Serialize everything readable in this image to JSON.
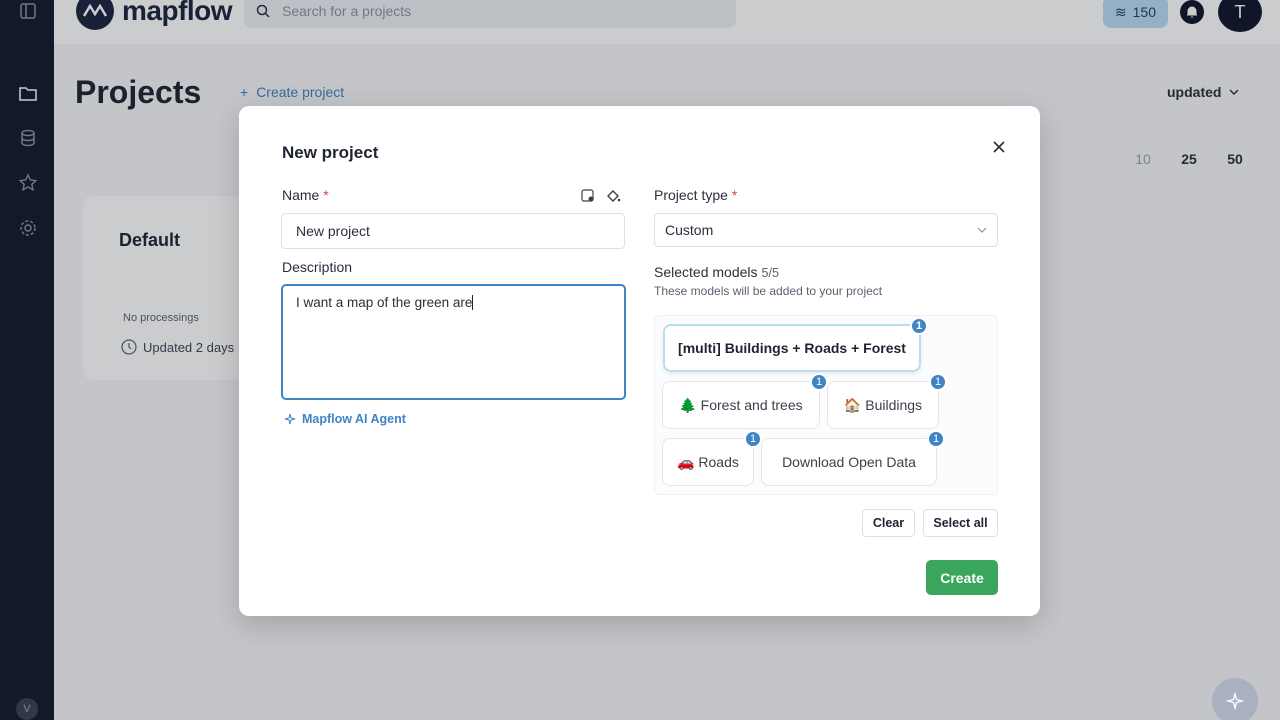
{
  "app": {
    "name": "mapflow"
  },
  "topbar": {
    "search_placeholder": "Search for a projects",
    "credits": "150",
    "avatar_initial": "T"
  },
  "sidebar": {
    "items": [
      "projects-icon",
      "database-icon",
      "star-icon",
      "settings-icon"
    ],
    "bottom_avatar": "V"
  },
  "page": {
    "title": "Projects",
    "create_link": "Create project",
    "sort_label": "updated",
    "page_sizes": [
      "10",
      "25",
      "50"
    ],
    "card": {
      "title": "Default",
      "processings": "No processings",
      "updated": "Updated 2 days"
    }
  },
  "modal": {
    "title": "New project",
    "name_label": "Name",
    "name_value": "New project",
    "description_label": "Description",
    "description_value": "I want a map of the green are",
    "ai_agent_link": "Mapflow AI Agent",
    "project_type_label": "Project type",
    "project_type_value": "Custom",
    "required_mark": "*",
    "selected_models_label": "Selected models",
    "selected_models_count": "5/5",
    "selected_models_desc": "These models will be added to your project",
    "models": [
      {
        "label": "[multi] Buildings + Roads + Forest",
        "badge": "1"
      },
      {
        "label": "🌲 Forest and trees",
        "badge": "1"
      },
      {
        "label": "🏠 Buildings",
        "badge": "1"
      },
      {
        "label": "🚗 Roads",
        "badge": "1"
      },
      {
        "label": "Download Open Data",
        "badge": "1"
      }
    ],
    "clear_label": "Clear",
    "select_all_label": "Select all",
    "create_label": "Create"
  },
  "colors": {
    "accent": "#3f84c4",
    "create": "#3aa55c",
    "sidebar": "#141a2e"
  }
}
